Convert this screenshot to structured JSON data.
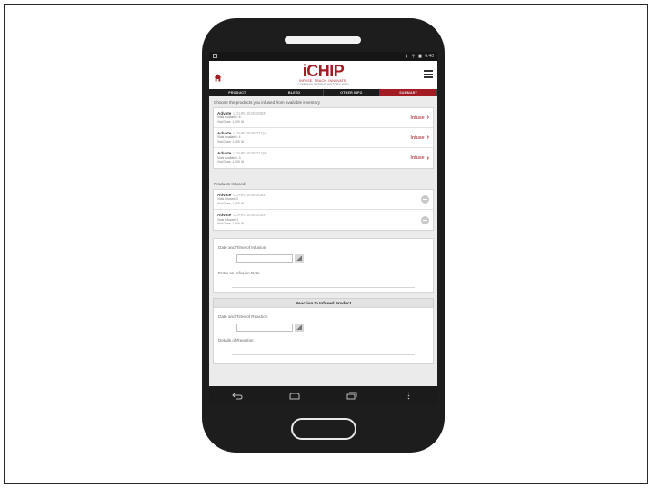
{
  "status_bar": {
    "left_icon": "notification-icon",
    "time": "6:40"
  },
  "app": {
    "logo_text": "iCHIP",
    "logo_subtitle": "INFUSE. TRACK. INNOVATE.",
    "logo_tagline": "COMPANY PATIENT HISTORY INFO"
  },
  "tabs": [
    {
      "label": "PRODUCT",
      "active": false
    },
    {
      "label": "BLEED",
      "active": false
    },
    {
      "label": "OTHER INFO",
      "active": false
    },
    {
      "label": "SUMMARY",
      "active": true
    }
  ],
  "available": {
    "heading": "Choose the products you infused from available inventory",
    "items": [
      {
        "name": "Advate",
        "lot": "LOHR1004020ER",
        "vials": "Vials Available: 8",
        "dose": "Vial Dose: 1,000 IU",
        "action": "Infuse"
      },
      {
        "name": "Advate",
        "lot": "LOHR1004021QA",
        "vials": "Vials Available: 4",
        "dose": "Vial Dose: 1,000 IU",
        "action": "Infuse"
      },
      {
        "name": "Advate",
        "lot": "LOHR1004021QB",
        "vials": "Vials Available: 3",
        "dose": "Vial Dose: 1,000 IU",
        "action": "Infuse"
      }
    ]
  },
  "infused": {
    "heading": "Products Infused:",
    "items": [
      {
        "name": "Advate",
        "lot": "LOHR1004020ER",
        "vials": "Vials Infused: 2",
        "dose": "Vial Dose: 1,000 IU"
      },
      {
        "name": "Advate",
        "lot": "LOHR1004020ER",
        "vials": "Vials Infused: 1",
        "dose": "Vial Dose: 1,000 IU"
      }
    ]
  },
  "infusion_form": {
    "datetime_label": "Date and Time of Infusion",
    "datetime_value": "",
    "note_label": "Enter an Infusion Note",
    "note_value": ""
  },
  "reaction": {
    "section_title": "Reaction to Infused Product",
    "datetime_label": "Date and Time of Reaction",
    "datetime_value": "",
    "details_label": "Details of Reaction",
    "details_value": ""
  },
  "colors": {
    "brand": "#a31c24",
    "tab_bar": "#1c1c1c",
    "background": "#ebebeb"
  }
}
